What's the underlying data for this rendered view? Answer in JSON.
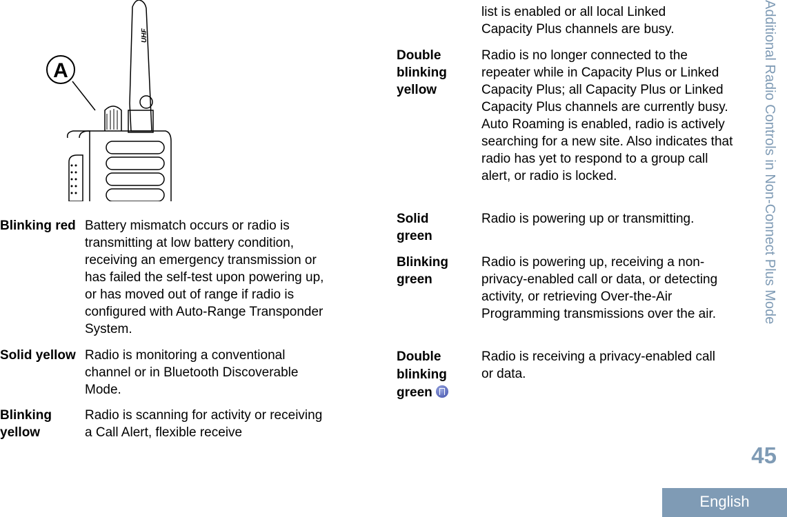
{
  "illustration": {
    "callout_label": "A",
    "antenna_label": "UHF"
  },
  "left_rows": [
    {
      "term": "Blinking red",
      "desc": "Battery mismatch occurs or radio is transmitting at low battery condition, receiving an emergency transmission or has failed the self-test upon powering up, or has moved out of range if radio is configured with Auto-Range Transponder System."
    },
    {
      "term": "Solid yellow",
      "desc": "Radio is monitoring a conventional channel or in Bluetooth Discoverable Mode."
    },
    {
      "term": "Blinking yellow",
      "desc": "Radio is scanning for activity or receiving a Call Alert, flexible receive"
    }
  ],
  "right_continuation": "list is enabled or all local Linked Capacity Plus channels are busy.",
  "right_rows": [
    {
      "term": "Double blinking yellow",
      "desc": "Radio is no longer connected to the repeater while in Capacity Plus or Linked Capacity Plus; all Capacity Plus or Linked Capacity Plus channels are currently busy. Auto Roaming is enabled, radio is actively searching for a new site. Also indicates that radio has yet to respond to a group call alert, or radio is locked."
    },
    {
      "term": "Solid green",
      "desc": "Radio is powering up or transmitting."
    },
    {
      "term": "Blinking green",
      "desc": "Radio is powering up, receiving a non-privacy-enabled call or data, or detecting activity, or retrieving Over-the-Air Programming transmissions over the air."
    },
    {
      "term": "Double blinking green",
      "desc": "Radio is receiving a privacy-enabled call or data.",
      "icon": "privacy-icon"
    }
  ],
  "side_title": "Additional Radio Controls in Non-Connect Plus Mode",
  "page_number": "45",
  "language": "English",
  "accent_color": "#7f9bb5"
}
